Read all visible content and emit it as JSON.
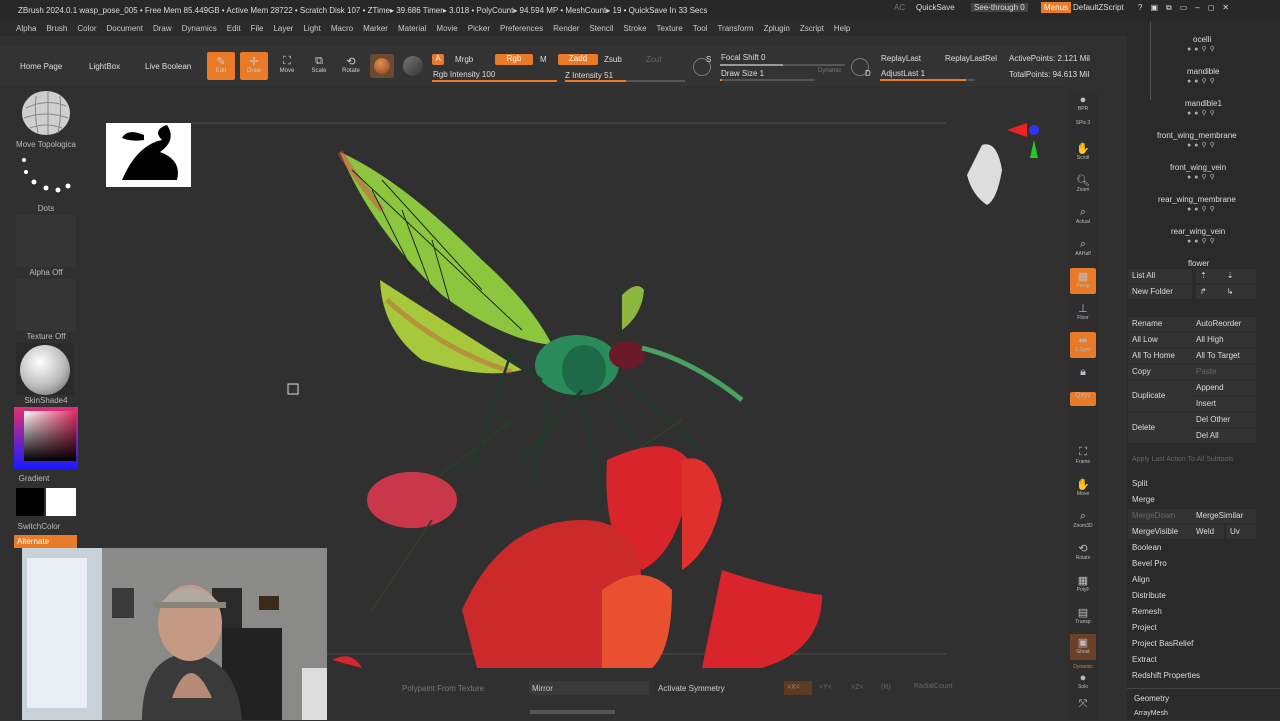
{
  "titlebar": {
    "text": "ZBrush 2024.0.1   wasp_pose_005   • Free Mem 85.449GB • Active Mem 28722 • Scratch Disk 107 • ZTime▸ 39.686 Timer▸ 3.018 • PolyCount▸ 94.594 MP • MeshCount▸ 19  • QuickSave In 33 Secs",
    "ac": "AC",
    "quicksave": "QuickSave",
    "seethrough": "See-through  0",
    "menus": "Menus",
    "script": "DefaultZScript"
  },
  "menu": [
    "Alpha",
    "Brush",
    "Color",
    "Document",
    "Draw",
    "Dynamics",
    "Edit",
    "File",
    "Layer",
    "Light",
    "Macro",
    "Marker",
    "Material",
    "Movie",
    "Picker",
    "Preferences",
    "Render",
    "Stencil",
    "Stroke",
    "Texture",
    "Tool",
    "Transform",
    "Zplugin",
    "Zscript",
    "Help"
  ],
  "toolbar": {
    "home": "Home Page",
    "lightbox": "LightBox",
    "liveboolean": "Live Boolean",
    "edit": "Edit",
    "draw": "Draw",
    "move": "Move",
    "scale": "Scale",
    "rotate": "Rotate",
    "a": "A",
    "mrgb": "Mrgb",
    "rgb": "Rgb",
    "m": "M",
    "zadd": "Zadd",
    "zsub": "Zsub",
    "zcut": "Zcut",
    "rgb_intensity": "Rgb Intensity 100",
    "z_intensity": "Z Intensity 51",
    "focal_shift": "Focal Shift 0",
    "draw_size": "Draw Size 1",
    "dynamic": "Dynamic",
    "replaylast": "ReplayLast",
    "replaylastrel": "ReplayLastRel",
    "adjustlast": "AdjustLast  1",
    "activepoints": "ActivePoints: 2.121 Mil",
    "totalpoints": "TotalPoints: 94.613 Mil",
    "s": "S",
    "d": "D"
  },
  "leftshelf": {
    "brush": "Move Topologica",
    "stroke": "Dots",
    "alpha": "Alpha Off",
    "texture": "Texture Off",
    "material": "SkinShade4",
    "gradient": "Gradient",
    "switchcolor": "SwitchColor",
    "alternate": "Alternate"
  },
  "rightshelf": [
    "BPR",
    "SPix 3",
    "Scroll",
    "Zoom",
    "Actual",
    "AAHalf",
    "Persp",
    "Floor",
    "L.Sym",
    "Qxyz",
    "Frame",
    "Move",
    "Zoom3D",
    "Rotate",
    "PolyF",
    "Transp",
    "Ghost",
    "Dynamic",
    "Solo"
  ],
  "subtools": [
    {
      "name": "ocelli"
    },
    {
      "name": "mandible"
    },
    {
      "name": "mandible1"
    },
    {
      "name": "front_wing_membrane"
    },
    {
      "name": "front_wing_vein"
    },
    {
      "name": "rear_wing_membrane"
    },
    {
      "name": "rear_wing_vein"
    },
    {
      "name": "flower"
    }
  ],
  "panel": {
    "listall": "List All",
    "newfolder": "New Folder",
    "rename": "Rename",
    "autoreorder": "AutoReorder",
    "alllow": "All Low",
    "allhigh": "All High",
    "alltohome": "All To Home",
    "alltotarget": "All To Target",
    "copy": "Copy",
    "paste": "Paste",
    "duplicate": "Duplicate",
    "append": "Append",
    "insert": "Insert",
    "delete": "Delete",
    "delother": "Del Other",
    "delall": "Del All",
    "applylast": "Apply Last Action To All Subtools",
    "split": "Split",
    "merge": "Merge",
    "mergedown": "MergeDown",
    "mergesimilar": "MergeSimilar",
    "mergevisible": "MergeVisible",
    "weld": "Weld",
    "uv": "Uv",
    "boolean": "Boolean",
    "bevelpro": "Bevel Pro",
    "align": "Align",
    "distribute": "Distribute",
    "remesh": "Remesh",
    "project": "Project",
    "projectbas": "Project BasRelief",
    "extract": "Extract",
    "redshift": "Redshift Properties",
    "geometry": "Geometry",
    "arraymesh": "ArrayMesh"
  },
  "bottombar": {
    "polypaint": "Polypaint From Texture",
    "mirror": "Mirror",
    "symmetry": "Activate Symmetry",
    "x": ">X<",
    "y": ">Y<",
    "z": ">Z<",
    "r": "(R)",
    "radial": "RadialCount"
  },
  "colors": {
    "accent": "#e87a28",
    "bg": "#303030",
    "wing": "#8cc63e",
    "flower": "#d8242a",
    "body": "#2a8a5a"
  }
}
